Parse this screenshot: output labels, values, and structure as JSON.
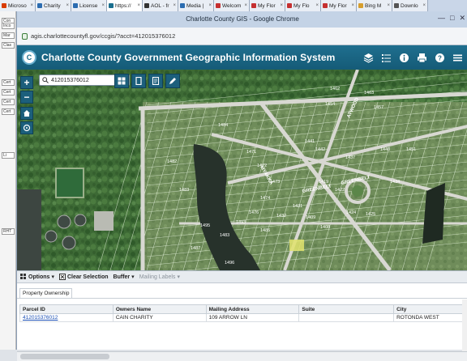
{
  "browser": {
    "tabs": [
      {
        "label": "Microso",
        "color": "#d83b01"
      },
      {
        "label": "Charity",
        "color": "#2b6cb0"
      },
      {
        "label": "License",
        "color": "#2b6cb0"
      },
      {
        "label": "https://",
        "color": "#1b6f8e",
        "active": true
      },
      {
        "label": "AOL - fr",
        "color": "#333333"
      },
      {
        "label": "Media |",
        "color": "#2b6cb0"
      },
      {
        "label": "Welcom",
        "color": "#c53030"
      },
      {
        "label": "My Flor",
        "color": "#c53030"
      },
      {
        "label": "My Flo",
        "color": "#c53030"
      },
      {
        "label": "My Flor",
        "color": "#c53030"
      },
      {
        "label": "Bing M",
        "color": "#d69e2e"
      },
      {
        "label": "Downlo",
        "color": "#555555"
      }
    ],
    "window_title": "Charlotte County GIS - Google Chrome",
    "url": "agis.charlottecountyfl.gov/ccgis/?acct=412015376012"
  },
  "left_strip": {
    "items": [
      "Con",
      "Inco",
      "Mar",
      "Clas",
      "Cert",
      "Cert",
      "Cert",
      "Cert",
      "Li",
      "RHT"
    ]
  },
  "app": {
    "title": "Charlotte County Government Geographic Information System",
    "logo_letter": "C",
    "header_icons": [
      "layers-icon",
      "list-icon",
      "info-icon",
      "print-icon",
      "help-icon",
      "menu-icon"
    ],
    "search": {
      "value": "412015376012"
    },
    "zoom_in": "+",
    "zoom_out": "−",
    "tools": [
      "grid-icon",
      "map-frame-icon",
      "document-icon",
      "pencil-icon"
    ]
  },
  "map_labels": {
    "parcels": [
      "1482",
      "1483",
      "1484",
      "1471",
      "1472",
      "1473",
      "1474",
      "1476",
      "1462",
      "1463",
      "1454",
      "1457",
      "1441",
      "1442",
      "1437",
      "1440",
      "1451",
      "1419",
      "1422",
      "1434",
      "1424",
      "1425",
      "1409",
      "1408",
      "1483",
      "1487",
      "1495",
      "1496",
      "1493",
      "1431",
      "1432",
      "1485"
    ],
    "streets": [
      "GREENBELT",
      "GREENBELT",
      "MYAKKA",
      "ATWOOD"
    ]
  },
  "panel": {
    "options_label": "Options",
    "clear_label": "Clear Selection",
    "buffer_label": "Buffer",
    "mailing_label": "Mailing Labels",
    "tab_label": "Property Ownership",
    "columns": [
      "Parcel ID",
      "Owners Name",
      "Mailing Address",
      "Suite",
      "City"
    ],
    "rows": [
      [
        "412015376012",
        "CAIN CHARITY",
        "109 ARROW LN",
        "",
        "ROTONDA WEST"
      ]
    ]
  }
}
